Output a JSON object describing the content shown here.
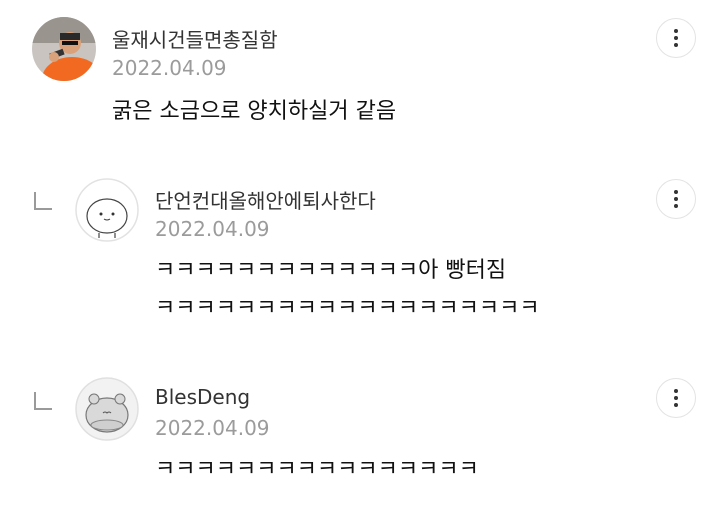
{
  "comments": [
    {
      "author": "울재시건들면총질함",
      "date": "2022.04.09",
      "lines": [
        "굵은 소금으로 양치하실거 같음"
      ],
      "avatar_icon": "profile-photo-orange-shirt",
      "is_reply": false
    },
    {
      "author": "단언컨대올해안에퇴사한다",
      "date": "2022.04.09",
      "lines": [
        "ㅋㅋㅋㅋㅋㅋㅋㅋㅋㅋㅋㅋㅋ아 빵터짐",
        "ㅋㅋㅋㅋㅋㅋㅋㅋㅋㅋㅋㅋㅋㅋㅋㅋㅋㅋㅋ"
      ],
      "avatar_icon": "default-character-avatar",
      "is_reply": true
    },
    {
      "author": "BlesDeng",
      "date": "2022.04.09",
      "lines": [
        "ㅋㅋㅋㅋㅋㅋㅋㅋㅋㅋㅋㅋㅋㅋㅋㅋ"
      ],
      "avatar_icon": "grey-character-avatar",
      "is_reply": true
    }
  ],
  "more_icon": "more-vertical-icon",
  "colors": {
    "date": "#9b9b9b",
    "accent_orange": "#f26a21"
  }
}
